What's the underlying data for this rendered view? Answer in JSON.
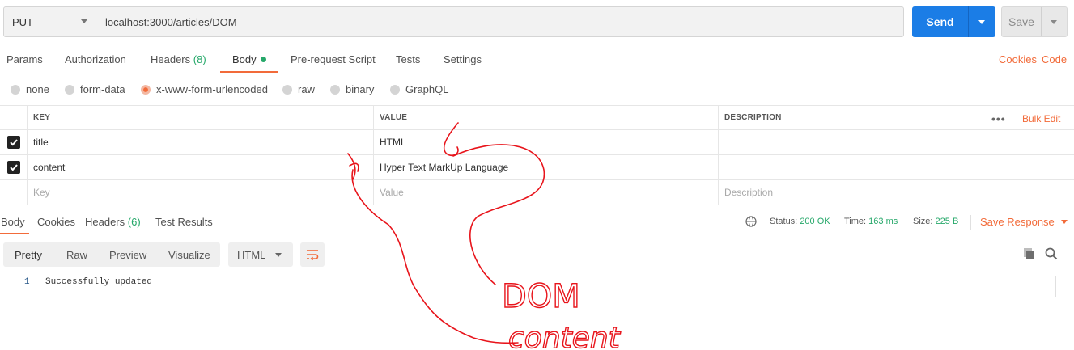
{
  "request": {
    "method": "PUT",
    "url": "localhost:3000/articles/DOM",
    "send_label": "Send",
    "save_label": "Save"
  },
  "request_tabs": [
    {
      "label": "Params"
    },
    {
      "label": "Authorization"
    },
    {
      "label": "Headers",
      "count": "(8)"
    },
    {
      "label": "Body",
      "active": true
    },
    {
      "label": "Pre-request Script"
    },
    {
      "label": "Tests"
    },
    {
      "label": "Settings"
    }
  ],
  "right_links": {
    "cookies": "Cookies",
    "code": "Code"
  },
  "body_types": [
    {
      "label": "none"
    },
    {
      "label": "form-data"
    },
    {
      "label": "x-www-form-urlencoded",
      "selected": true
    },
    {
      "label": "raw"
    },
    {
      "label": "binary"
    },
    {
      "label": "GraphQL"
    }
  ],
  "table": {
    "headers": {
      "key": "KEY",
      "value": "VALUE",
      "description": "DESCRIPTION"
    },
    "bulk_edit": "Bulk Edit",
    "more": "•••",
    "rows": [
      {
        "checked": true,
        "key": "title",
        "value": "HTML",
        "description": ""
      },
      {
        "checked": true,
        "key": "content",
        "value": "Hyper Text MarkUp Language",
        "description": ""
      }
    ],
    "placeholders": {
      "key": "Key",
      "value": "Value",
      "description": "Description"
    }
  },
  "response_tabs": [
    {
      "label": "Body",
      "active": true
    },
    {
      "label": "Cookies"
    },
    {
      "label": "Headers",
      "count": "(6)"
    },
    {
      "label": "Test Results"
    }
  ],
  "response_meta": {
    "status_label": "Status:",
    "status_value": "200 OK",
    "time_label": "Time:",
    "time_value": "163 ms",
    "size_label": "Size:",
    "size_value": "225 B",
    "save_response": "Save Response"
  },
  "view_modes": [
    {
      "label": "Pretty",
      "active": true
    },
    {
      "label": "Raw"
    },
    {
      "label": "Preview"
    },
    {
      "label": "Visualize"
    }
  ],
  "format": "HTML",
  "response_body": [
    {
      "line": "1",
      "text": "Successfully updated"
    }
  ],
  "annotation": {
    "text_1": "DOM",
    "text_2": "content",
    "color": "#e8141b"
  },
  "colors": {
    "accent": "#f26b3a",
    "primary": "#1b7de6",
    "success": "#26a86a"
  },
  "icons": [
    "chevron-down-icon",
    "checkmark-icon",
    "globe-icon",
    "wrap-lines-icon",
    "copy-icon",
    "search-icon",
    "more-dots-icon"
  ]
}
